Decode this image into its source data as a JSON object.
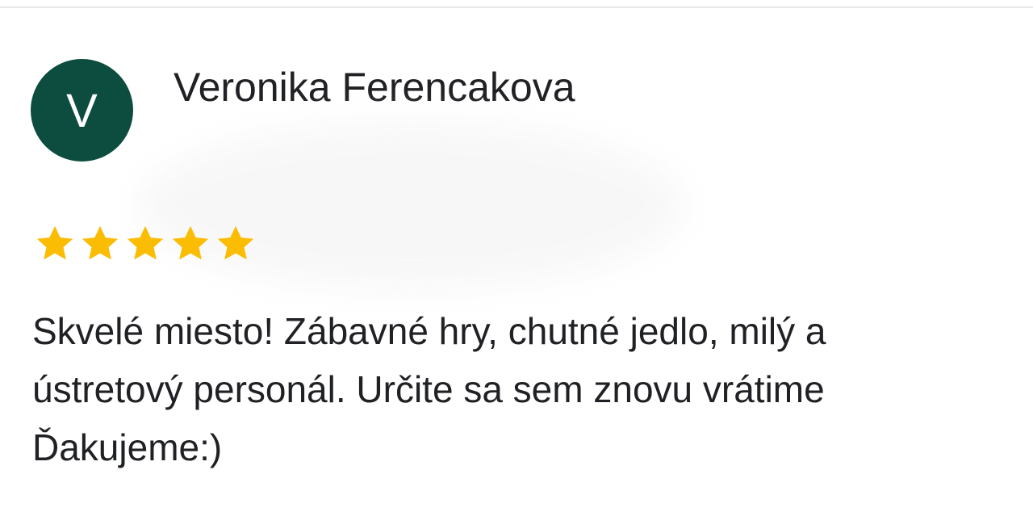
{
  "review": {
    "avatar_letter": "V",
    "reviewer_name": "Veronika Ferencakova",
    "rating": 5,
    "rating_max": 5,
    "star_color": "#FBBC04",
    "avatar_color": "#0D4D3F",
    "text_lines": [
      "Skvelé miesto! Zábavné hry, chutné jedlo, milý a",
      "ústretový personál. Určite sa sem znovu vrátime",
      "Ďakujeme:)"
    ]
  }
}
